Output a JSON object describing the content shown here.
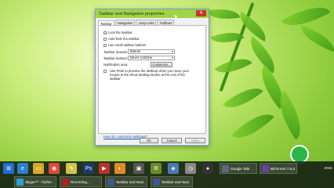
{
  "dialog": {
    "title": "Taskbar and Navigation properties",
    "close_glyph": "✕",
    "tabs": [
      "Taskbar",
      "Navigation",
      "Jump Lists",
      "Toolbars"
    ],
    "checkboxes": [
      {
        "label": "Lock the taskbar",
        "checked": true
      },
      {
        "label": "Auto-hide the taskbar",
        "checked": false
      },
      {
        "label": "Use small taskbar buttons",
        "checked": false
      }
    ],
    "location_label": "Taskbar location on screen:",
    "location_value": "Bottom",
    "buttons_label": "Taskbar buttons:",
    "buttons_value": "Never combine",
    "notification_label": "Notification area:",
    "customize_label": "Customize...",
    "peek_text": "Use Peek to preview the desktop when you move your mouse to the Show desktop button at the end of the taskbar",
    "help_link": "How do I customize taskbars?",
    "ok_label": "OK",
    "cancel_label": "Cancel",
    "apply_label": "Apply"
  },
  "taskbar": {
    "tasks_top": [
      {
        "label": "Google Talk",
        "color": "#5d6b7a"
      },
      {
        "label": "BitTorrent 7.8.2",
        "color": "#6a3fa0"
      }
    ],
    "tasks_bottom": [
      {
        "label": "Skype™ - foxfire...",
        "color": "#2a9fd6"
      },
      {
        "label": "Recording...",
        "color": "#b02020"
      },
      {
        "label": "Taskbar and Navi...",
        "color": "#3b5a8a"
      },
      {
        "label": "Taskbar and Navi...",
        "color": "#3b5a8a"
      }
    ],
    "tray_text": "ENG"
  },
  "icons": [
    "start-icon",
    "ie-icon",
    "explorer-icon",
    "chrome-icon",
    "notes-icon",
    "photoshop-icon",
    "media-icon",
    "firefox-icon",
    "app-icon",
    "settings-icon",
    "gallery-icon",
    "clock-icon",
    "recorder-icon"
  ]
}
